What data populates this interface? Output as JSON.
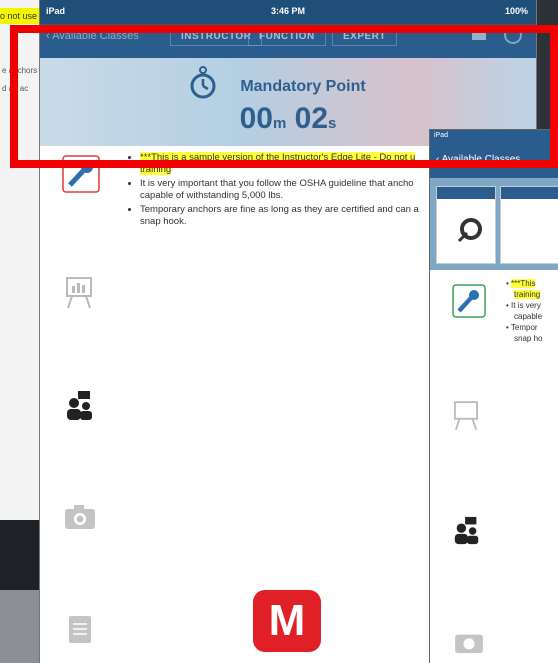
{
  "bg_left": {
    "highlight_text": "o not use",
    "line1": "e anchors",
    "line2": "d an ac"
  },
  "main": {
    "status": {
      "carrier": "iPad",
      "time": "3:46 PM",
      "battery": "100%"
    },
    "nav": {
      "back_label": "Available Classes",
      "tabs": [
        "INSTRUCTOR",
        "FUNCTION",
        "EXPERT"
      ]
    },
    "hero": {
      "title": "Mandatory Point",
      "minutes": "00",
      "minutes_unit": "m",
      "seconds": "02",
      "seconds_unit": "s"
    },
    "bullets": {
      "b1": "***This is a sample version of the Instructor's Edge Lite - Do not u",
      "b1b": "training",
      "b2": "It is very important that you follow the OSHA guideline that ancho",
      "b2b": "capable of withstanding 5,000 lbs.",
      "b3": "Temporary anchors are fine as long as they are certified and can a",
      "b3b": "snap hook."
    },
    "m_button": "M"
  },
  "right": {
    "carrier": "iPad",
    "back_label": "Available Classes",
    "lines": [
      "***This",
      "training",
      "It is very",
      "capable",
      "Tempor",
      "snap ho"
    ]
  },
  "colors": {
    "nav": "#2a5d8e",
    "highlight": "#ffff3a",
    "frame": "#f00000",
    "m_button": "#e01f26"
  }
}
